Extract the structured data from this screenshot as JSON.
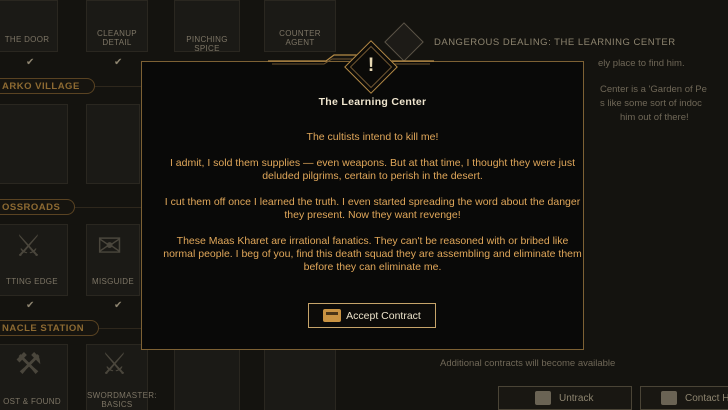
{
  "board": {
    "top_tiles": [
      "THE DOOR",
      "CLEANUP DETAIL",
      "PINCHING SPICE",
      "COUNTER AGENT"
    ],
    "sections": [
      "ARKO VILLAGE",
      "OSSROADS",
      "NACLE STATION"
    ],
    "mid_tiles": [
      "TTING EDGE",
      "MISGUIDE"
    ],
    "bottom_tiles": [
      "OST & FOUND",
      "SWORDMASTER: BASICS"
    ]
  },
  "side_panel": {
    "title": "DANGEROUS DEALING: THE LEARNING CENTER",
    "line1": "ely place to find him.",
    "line2a": "Center is a 'Garden of Pe",
    "line2b": "s like some sort of indoc",
    "line2c": "him out of there!",
    "note": "Additional contracts will become available",
    "untrack_label": "Untrack",
    "contact_label": "Contact H"
  },
  "modal": {
    "emblem": "!",
    "title": "The Learning Center",
    "paragraphs": [
      "The cultists intend to kill me!",
      "I admit, I sold them supplies — even weapons. But at that time, I thought they were just deluded pilgrims, certain to perish in the desert.",
      "I cut them off once I learned the truth. I even started spreading the word about the danger they present. Now they want revenge!",
      "These Maas Kharet are irrational fanatics. They can't be reasoned with or bribed like normal people. I beg of you, find this death squad they are assembling and eliminate them before they can eliminate me."
    ],
    "accept_label": "Accept Contract"
  },
  "colors": {
    "accent_gold": "#c6a46a",
    "body_text": "#e0a75a",
    "title_text": "#f0e6cf"
  }
}
